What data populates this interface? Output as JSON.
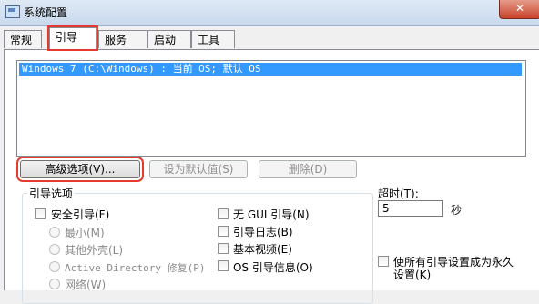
{
  "window": {
    "title": "系统配置",
    "close_symbol": "✕"
  },
  "tabs": [
    {
      "label": "常规"
    },
    {
      "label": "引导"
    },
    {
      "label": "服务"
    },
    {
      "label": "启动"
    },
    {
      "label": "工具"
    }
  ],
  "boot_list": {
    "items": [
      "Windows 7 (C:\\Windows) : 当前 OS; 默认 OS"
    ]
  },
  "buttons": {
    "advanced": "高级选项(V)...",
    "set_default": "设为默认值(S)",
    "delete": "删除(D)"
  },
  "boot_options": {
    "label": "引导选项",
    "safe_boot": "安全引导(F)",
    "minimal": "最小(M)",
    "alternate_shell": "其他外壳(L)",
    "active_directory": "Active Directory 修复(P)",
    "network": "网络(W)",
    "no_gui_boot": "无 GUI 引导(N)",
    "boot_log": "引导日志(B)",
    "base_video": "基本视频(E)",
    "os_boot_info": "OS 引导信息(O)"
  },
  "timeout": {
    "label": "超时(T):",
    "value": "5",
    "unit": "秒"
  },
  "permanent": {
    "label_line1": "使所有引导设置成为永久",
    "label_line2": "设置(K)"
  },
  "colors": {
    "highlight_red": "#e53a2d",
    "selection_blue": "#3399ff"
  }
}
